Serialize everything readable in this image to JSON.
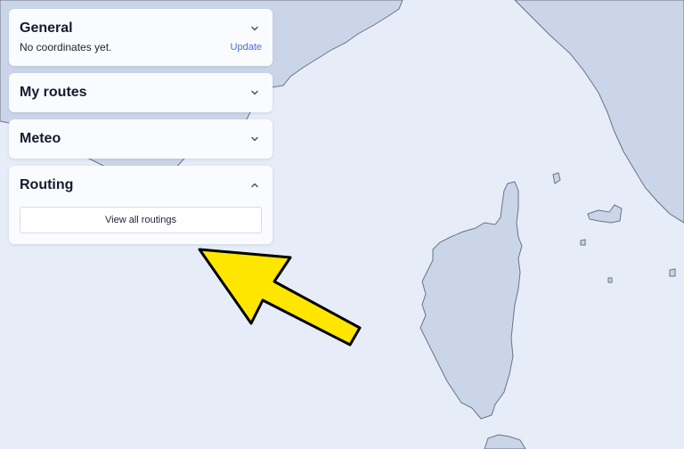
{
  "map": {
    "sea_color": "#e6ecf8",
    "land_color": "#cbd5ea",
    "coast_color": "#6b7280"
  },
  "sidebar": {
    "general": {
      "title": "General",
      "status_text": "No coordinates yet.",
      "update_label": "Update",
      "expanded": true
    },
    "my_routes": {
      "title": "My routes",
      "expanded": false
    },
    "meteo": {
      "title": "Meteo",
      "expanded": false
    },
    "routing": {
      "title": "Routing",
      "button_label": "View all routings",
      "expanded": true
    }
  },
  "annotation": {
    "arrow_color": "#ffe600",
    "arrow_outline": "#000000"
  }
}
